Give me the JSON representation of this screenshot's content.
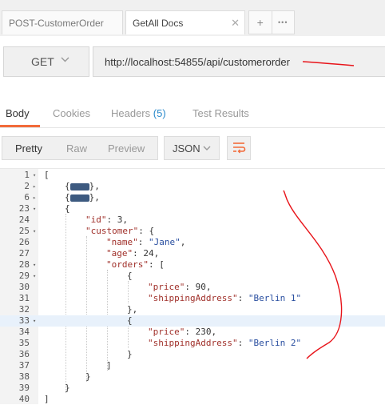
{
  "tabs": [
    {
      "label": "POST-CustomerOrder",
      "active": false
    },
    {
      "label": "GetAll Docs",
      "active": true
    }
  ],
  "tab_tools": {
    "add_label": "+",
    "more_label": "•••"
  },
  "request": {
    "method": "GET",
    "url": "http://localhost:54855/api/customerorder"
  },
  "response_tabs": {
    "body": "Body",
    "cookies": "Cookies",
    "headers": "Headers",
    "headers_count": "(5)",
    "test_results": "Test Results"
  },
  "view_modes": {
    "pretty": "Pretty",
    "raw": "Raw",
    "preview": "Preview",
    "selected": "Pretty"
  },
  "format": {
    "selected": "JSON"
  },
  "editor": {
    "highlighted_line": "33",
    "lines": [
      {
        "no": "1"
      },
      {
        "no": "2"
      },
      {
        "no": "6"
      },
      {
        "no": "23"
      },
      {
        "no": "24"
      },
      {
        "no": "25"
      },
      {
        "no": "26"
      },
      {
        "no": "27"
      },
      {
        "no": "28"
      },
      {
        "no": "29"
      },
      {
        "no": "30"
      },
      {
        "no": "31"
      },
      {
        "no": "32"
      },
      {
        "no": "33"
      },
      {
        "no": "34"
      },
      {
        "no": "35"
      },
      {
        "no": "36"
      },
      {
        "no": "37"
      },
      {
        "no": "38"
      },
      {
        "no": "39"
      },
      {
        "no": "40"
      }
    ],
    "tokens": {
      "open_array": "[",
      "fold_open": "{",
      "fold_close": "},",
      "open_obj": "{",
      "id_key": "\"id\"",
      "id_val": "3",
      "customer_key": "\"customer\"",
      "name_key": "\"name\"",
      "name_val": "\"Jane\"",
      "age_key": "\"age\"",
      "age_val": "24",
      "orders_key": "\"orders\"",
      "price_key": "\"price\"",
      "price1_val": "90",
      "addr_key": "\"shippingAddress\"",
      "addr1_val": "\"Berlin 1\"",
      "price2_val": "230",
      "addr2_val": "\"Berlin 2\"",
      "close_obj_comma": "},",
      "close_obj": "}",
      "close_array": "]"
    }
  },
  "colors": {
    "accent": "#f26b3a",
    "link": "#2a8acc",
    "annotation": "#e8141a"
  }
}
